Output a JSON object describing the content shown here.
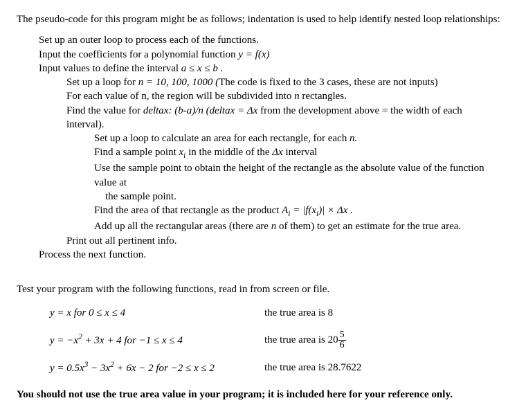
{
  "intro": "The pseudo-code for this program might be as follows; indentation is used to help identify nested loop relationships:",
  "lines": {
    "l1": "Set up an outer loop to process each of the functions.",
    "l2a": "Input the coefficients for a polynomial function  ",
    "l2b": "y = f(x)",
    "l3a": "Input values to define the interval  ",
    "l3b": "a ≤ x ≤ b  .",
    "l4a": "Set up a loop for ",
    "l4b": "n = 10, 100, 1000 (",
    "l4c": "The code is fixed to the 3 cases, these are not inputs)",
    "l5a": "For each value of n, the region will be subdivided into ",
    "l5b": "n",
    "l5c": " rectangles.",
    "l6a": "Find the value for ",
    "l6b": "deltax: (b-a)/n  (deltax = ",
    "l6c": "Δx",
    "l6d": "  from the development above = the width of each interval).",
    "l7a": "Set up a loop to calculate an area for each rectangle, for each ",
    "l7b": "n.",
    "l8a": "Find a sample point ",
    "l8b": "x",
    "l8c": " in the middle of the ",
    "l8d": "Δx",
    "l8e": "  interval",
    "l9": "Use the sample point to obtain the height of the rectangle as the absolute value of the function value at the sample point.",
    "l10a": "Find the area of that rectangle as the product  ",
    "l10b": "A",
    "l10c": " = |f(x",
    "l10d": ")| × Δx .",
    "l11a": "Add up all the rectangular areas (there are ",
    "l11b": "n",
    "l11c": " of them) to get an estimate for the true area.",
    "l12": "Print out all pertinent info.",
    "l13": "Process the next function."
  },
  "test_intro": "Test your program with the following functions, read in from screen or file.",
  "eq1": {
    "lhs_a": "y = x   for   ",
    "lhs_b": "0 ≤ x ≤ 4",
    "rhs": "the true area is 8"
  },
  "eq2": {
    "lhs_a": "y = −x",
    "lhs_b": " + 3x + 4   for   −",
    "lhs_c": "1 ≤ x ≤ 4",
    "rhs_a": "the true area is 20",
    "frac_num": "5",
    "frac_den": "6"
  },
  "eq3": {
    "lhs_a": "y = ",
    "lhs_b": "0.5x",
    "lhs_c": " − 3x",
    "lhs_d": " + 6x − 2  for   −",
    "lhs_e": "2 ≤ x ≤ 2",
    "rhs": "the true area is 28.7622"
  },
  "footer": "You should not use the true area value in your program; it is included here for your reference only."
}
